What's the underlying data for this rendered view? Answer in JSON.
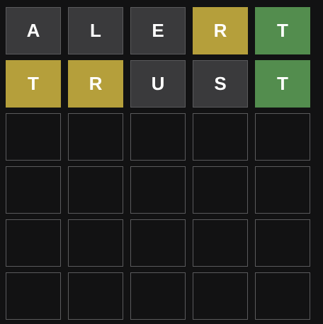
{
  "board": {
    "rows": [
      [
        {
          "letter": "A",
          "state": "absent"
        },
        {
          "letter": "L",
          "state": "absent"
        },
        {
          "letter": "E",
          "state": "absent"
        },
        {
          "letter": "R",
          "state": "present"
        },
        {
          "letter": "T",
          "state": "correct"
        }
      ],
      [
        {
          "letter": "T",
          "state": "present"
        },
        {
          "letter": "R",
          "state": "present"
        },
        {
          "letter": "U",
          "state": "absent"
        },
        {
          "letter": "S",
          "state": "absent"
        },
        {
          "letter": "T",
          "state": "correct"
        }
      ],
      [
        {
          "letter": "",
          "state": "empty"
        },
        {
          "letter": "",
          "state": "empty"
        },
        {
          "letter": "",
          "state": "empty"
        },
        {
          "letter": "",
          "state": "empty"
        },
        {
          "letter": "",
          "state": "empty"
        }
      ],
      [
        {
          "letter": "",
          "state": "empty"
        },
        {
          "letter": "",
          "state": "empty"
        },
        {
          "letter": "",
          "state": "empty"
        },
        {
          "letter": "",
          "state": "empty"
        },
        {
          "letter": "",
          "state": "empty"
        }
      ],
      [
        {
          "letter": "",
          "state": "empty"
        },
        {
          "letter": "",
          "state": "empty"
        },
        {
          "letter": "",
          "state": "empty"
        },
        {
          "letter": "",
          "state": "empty"
        },
        {
          "letter": "",
          "state": "empty"
        }
      ],
      [
        {
          "letter": "",
          "state": "empty"
        },
        {
          "letter": "",
          "state": "empty"
        },
        {
          "letter": "",
          "state": "empty"
        },
        {
          "letter": "",
          "state": "empty"
        },
        {
          "letter": "",
          "state": "empty"
        }
      ]
    ]
  },
  "colors": {
    "background": "#121213",
    "absent": "#3a3a3c",
    "present": "#b59f3b",
    "correct": "#538d4e",
    "empty_border": "#5a5a5c",
    "letter": "#ffffff"
  }
}
